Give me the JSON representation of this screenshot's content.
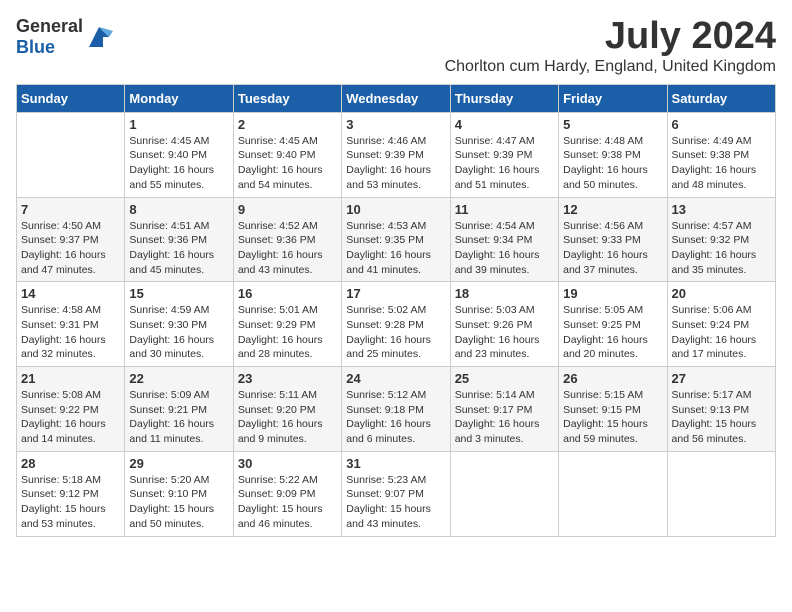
{
  "header": {
    "logo_general": "General",
    "logo_blue": "Blue",
    "month_year": "July 2024",
    "location": "Chorlton cum Hardy, England, United Kingdom"
  },
  "days_of_week": [
    "Sunday",
    "Monday",
    "Tuesday",
    "Wednesday",
    "Thursday",
    "Friday",
    "Saturday"
  ],
  "weeks": [
    [
      {
        "day": "",
        "info": ""
      },
      {
        "day": "1",
        "info": "Sunrise: 4:45 AM\nSunset: 9:40 PM\nDaylight: 16 hours\nand 55 minutes."
      },
      {
        "day": "2",
        "info": "Sunrise: 4:45 AM\nSunset: 9:40 PM\nDaylight: 16 hours\nand 54 minutes."
      },
      {
        "day": "3",
        "info": "Sunrise: 4:46 AM\nSunset: 9:39 PM\nDaylight: 16 hours\nand 53 minutes."
      },
      {
        "day": "4",
        "info": "Sunrise: 4:47 AM\nSunset: 9:39 PM\nDaylight: 16 hours\nand 51 minutes."
      },
      {
        "day": "5",
        "info": "Sunrise: 4:48 AM\nSunset: 9:38 PM\nDaylight: 16 hours\nand 50 minutes."
      },
      {
        "day": "6",
        "info": "Sunrise: 4:49 AM\nSunset: 9:38 PM\nDaylight: 16 hours\nand 48 minutes."
      }
    ],
    [
      {
        "day": "7",
        "info": "Sunrise: 4:50 AM\nSunset: 9:37 PM\nDaylight: 16 hours\nand 47 minutes."
      },
      {
        "day": "8",
        "info": "Sunrise: 4:51 AM\nSunset: 9:36 PM\nDaylight: 16 hours\nand 45 minutes."
      },
      {
        "day": "9",
        "info": "Sunrise: 4:52 AM\nSunset: 9:36 PM\nDaylight: 16 hours\nand 43 minutes."
      },
      {
        "day": "10",
        "info": "Sunrise: 4:53 AM\nSunset: 9:35 PM\nDaylight: 16 hours\nand 41 minutes."
      },
      {
        "day": "11",
        "info": "Sunrise: 4:54 AM\nSunset: 9:34 PM\nDaylight: 16 hours\nand 39 minutes."
      },
      {
        "day": "12",
        "info": "Sunrise: 4:56 AM\nSunset: 9:33 PM\nDaylight: 16 hours\nand 37 minutes."
      },
      {
        "day": "13",
        "info": "Sunrise: 4:57 AM\nSunset: 9:32 PM\nDaylight: 16 hours\nand 35 minutes."
      }
    ],
    [
      {
        "day": "14",
        "info": "Sunrise: 4:58 AM\nSunset: 9:31 PM\nDaylight: 16 hours\nand 32 minutes."
      },
      {
        "day": "15",
        "info": "Sunrise: 4:59 AM\nSunset: 9:30 PM\nDaylight: 16 hours\nand 30 minutes."
      },
      {
        "day": "16",
        "info": "Sunrise: 5:01 AM\nSunset: 9:29 PM\nDaylight: 16 hours\nand 28 minutes."
      },
      {
        "day": "17",
        "info": "Sunrise: 5:02 AM\nSunset: 9:28 PM\nDaylight: 16 hours\nand 25 minutes."
      },
      {
        "day": "18",
        "info": "Sunrise: 5:03 AM\nSunset: 9:26 PM\nDaylight: 16 hours\nand 23 minutes."
      },
      {
        "day": "19",
        "info": "Sunrise: 5:05 AM\nSunset: 9:25 PM\nDaylight: 16 hours\nand 20 minutes."
      },
      {
        "day": "20",
        "info": "Sunrise: 5:06 AM\nSunset: 9:24 PM\nDaylight: 16 hours\nand 17 minutes."
      }
    ],
    [
      {
        "day": "21",
        "info": "Sunrise: 5:08 AM\nSunset: 9:22 PM\nDaylight: 16 hours\nand 14 minutes."
      },
      {
        "day": "22",
        "info": "Sunrise: 5:09 AM\nSunset: 9:21 PM\nDaylight: 16 hours\nand 11 minutes."
      },
      {
        "day": "23",
        "info": "Sunrise: 5:11 AM\nSunset: 9:20 PM\nDaylight: 16 hours\nand 9 minutes."
      },
      {
        "day": "24",
        "info": "Sunrise: 5:12 AM\nSunset: 9:18 PM\nDaylight: 16 hours\nand 6 minutes."
      },
      {
        "day": "25",
        "info": "Sunrise: 5:14 AM\nSunset: 9:17 PM\nDaylight: 16 hours\nand 3 minutes."
      },
      {
        "day": "26",
        "info": "Sunrise: 5:15 AM\nSunset: 9:15 PM\nDaylight: 15 hours\nand 59 minutes."
      },
      {
        "day": "27",
        "info": "Sunrise: 5:17 AM\nSunset: 9:13 PM\nDaylight: 15 hours\nand 56 minutes."
      }
    ],
    [
      {
        "day": "28",
        "info": "Sunrise: 5:18 AM\nSunset: 9:12 PM\nDaylight: 15 hours\nand 53 minutes."
      },
      {
        "day": "29",
        "info": "Sunrise: 5:20 AM\nSunset: 9:10 PM\nDaylight: 15 hours\nand 50 minutes."
      },
      {
        "day": "30",
        "info": "Sunrise: 5:22 AM\nSunset: 9:09 PM\nDaylight: 15 hours\nand 46 minutes."
      },
      {
        "day": "31",
        "info": "Sunrise: 5:23 AM\nSunset: 9:07 PM\nDaylight: 15 hours\nand 43 minutes."
      },
      {
        "day": "",
        "info": ""
      },
      {
        "day": "",
        "info": ""
      },
      {
        "day": "",
        "info": ""
      }
    ]
  ]
}
